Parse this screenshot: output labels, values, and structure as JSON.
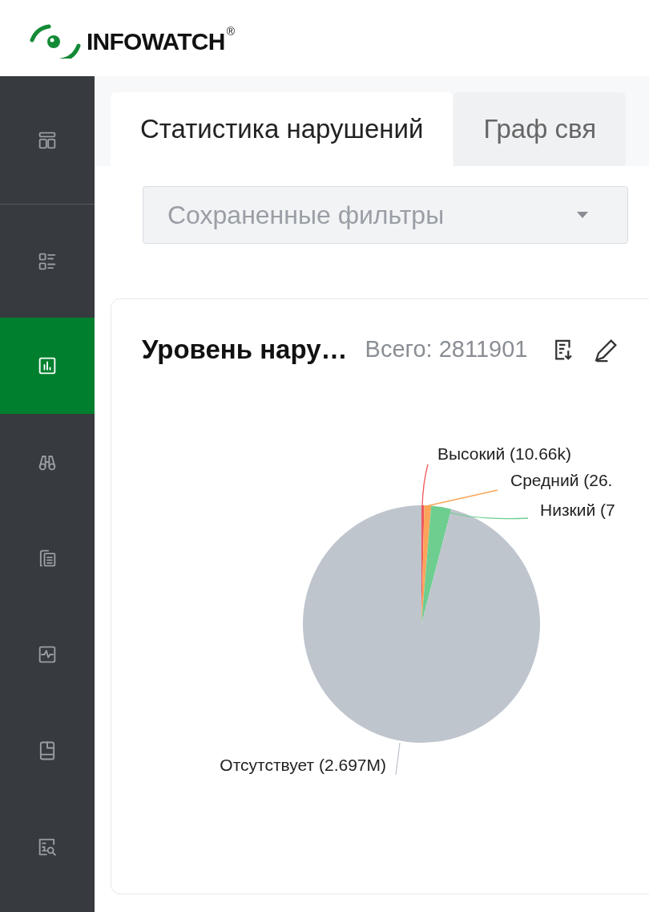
{
  "logo": {
    "text": "INFOWATCH",
    "mark": "®"
  },
  "sidebar": {
    "items": [
      {
        "kind": "dashboard",
        "selected": false
      },
      {
        "kind": "list",
        "selected": false
      },
      {
        "kind": "chart",
        "selected": true
      },
      {
        "kind": "binoculars",
        "selected": false
      },
      {
        "kind": "documents",
        "selected": false
      },
      {
        "kind": "activity",
        "selected": false
      },
      {
        "kind": "tablet",
        "selected": false
      },
      {
        "kind": "search-report",
        "selected": false
      }
    ]
  },
  "tabs": [
    {
      "label": "Статистика нарушений",
      "selected": true
    },
    {
      "label": "Граф свя",
      "selected": false
    }
  ],
  "filters_dropdown": {
    "placeholder": "Сохраненные фильтры"
  },
  "widget": {
    "title": "Уровень нару…",
    "total": "Всего: 2811901",
    "slices": [
      {
        "label": "Высокий (10.66k)",
        "color": "#f0575a"
      },
      {
        "label": "Средний (26.",
        "color": "#fca55a"
      },
      {
        "label": "Низкий (7",
        "color": "#6dce90"
      },
      {
        "label": "Отсутствует (2.697M)",
        "color": "#bfc5cd"
      }
    ]
  }
}
